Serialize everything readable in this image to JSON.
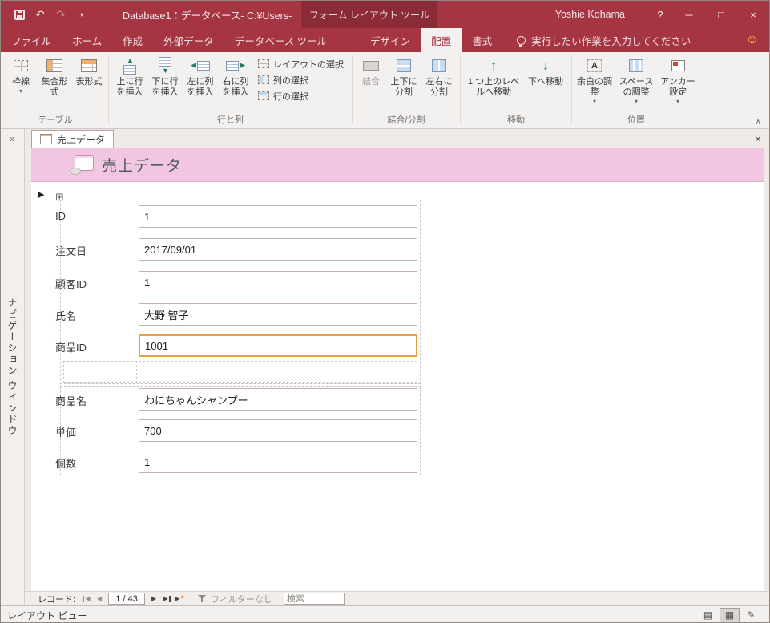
{
  "titlebar": {
    "title": "Database1：データベース- C:¥Users-",
    "context_tool_label": "フォーム レイアウト ツール",
    "user_name": "Yoshie Kohama"
  },
  "tabs": {
    "file": "ファイル",
    "home": "ホーム",
    "create": "作成",
    "external_data": "外部データ",
    "db_tools": "データベース ツール",
    "design": "デザイン",
    "arrange": "配置",
    "format": "書式",
    "tell_me": "実行したい作業を入力してください"
  },
  "ribbon": {
    "table_group": {
      "label": "テーブル",
      "gridlines": "枠線",
      "stacked": "集合形式",
      "tabular": "表形式"
    },
    "rows_cols_group": {
      "label": "行と列",
      "insert_above": "上に行を挿入",
      "insert_below": "下に行を挿入",
      "insert_left": "左に列を挿入",
      "insert_right": "右に列を挿入",
      "select_layout": "レイアウトの選択",
      "select_column": "列の選択",
      "select_row": "行の選択"
    },
    "merge_split_group": {
      "label": "結合/分割",
      "merge": "結合",
      "split_vertical": "上下に分割",
      "split_horizontal": "左右に分割"
    },
    "move_group": {
      "label": "移動",
      "move_up": "1 つ上のレベルへ移動",
      "move_down": "下へ移動"
    },
    "position_group": {
      "label": "位置",
      "margins": "余白の調整",
      "padding": "スペースの調整",
      "anchoring": "アンカー設定"
    }
  },
  "nav_pane": {
    "label": "ナビゲーション ウィンドウ"
  },
  "document": {
    "tab_label": "売上データ",
    "header_title": "売上データ"
  },
  "fields": {
    "group1": [
      {
        "label": "ID",
        "value": "1"
      },
      {
        "label": "注文日",
        "value": "2017/09/01"
      },
      {
        "label": "顧客ID",
        "value": "1"
      },
      {
        "label": "氏名",
        "value": "大野 智子"
      },
      {
        "label": "商品ID",
        "value": "1001"
      }
    ],
    "group2": [
      {
        "label": "商品名",
        "value": "わにちゃんシャンプー"
      },
      {
        "label": "単価",
        "value": "700"
      },
      {
        "label": "個数",
        "value": "1"
      }
    ]
  },
  "record_bar": {
    "label": "レコード:",
    "position": "1 / 43",
    "filter": "フィルターなし",
    "search_placeholder": "検索"
  },
  "status_bar": {
    "view_label": "レイアウト ビュー"
  },
  "colors": {
    "titlebar": "#A53542",
    "context_block": "#8B2B37",
    "form_header_pink": "#F2C5E0",
    "selection_orange": "#E9A33C"
  },
  "icons": {
    "undo": "↶",
    "redo": "↷",
    "qat_dropdown": "▾",
    "help": "?",
    "minimize": "─",
    "maximize": "□",
    "close": "×",
    "smiley": "☺",
    "dropdown": "▾",
    "ribbon_collapse": "∧",
    "nav_expand": "»",
    "layout_handle": "⊞",
    "record_selector": "▶",
    "nav_first": "◀",
    "nav_prev": "◀",
    "nav_next": "▶",
    "nav_last": "▶",
    "nav_new": "▶",
    "new_star": "*",
    "doc_close": "×",
    "view_form": "▤",
    "view_layout": "▦",
    "view_design": "✎"
  }
}
